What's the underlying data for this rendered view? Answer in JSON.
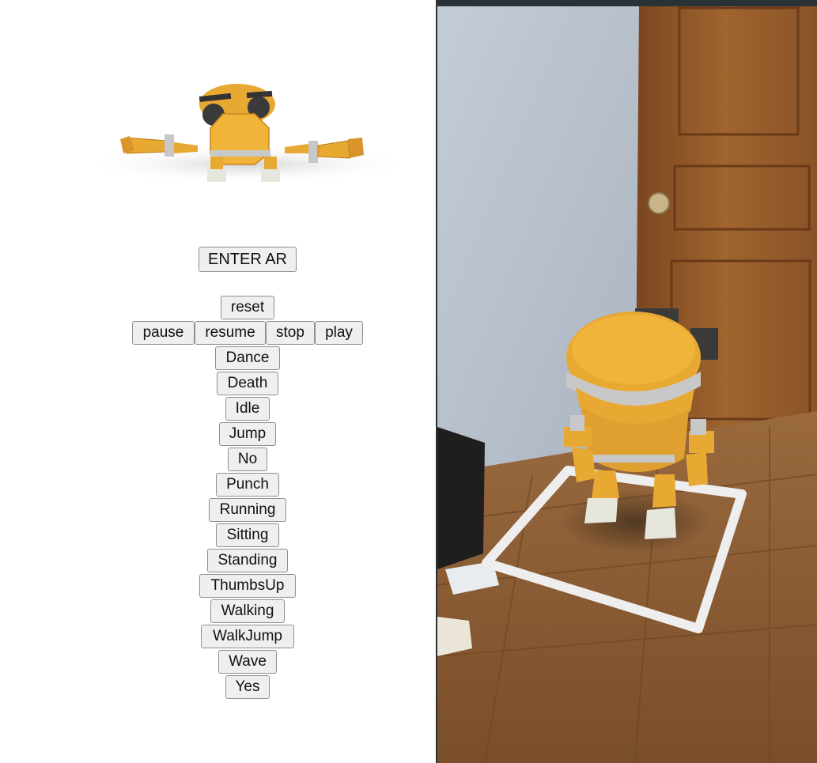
{
  "ar": {
    "enter_label": "ENTER AR"
  },
  "controls": {
    "reset": "reset",
    "pause": "pause",
    "resume": "resume",
    "stop": "stop",
    "play": "play"
  },
  "animations": [
    "Dance",
    "Death",
    "Idle",
    "Jump",
    "No",
    "Punch",
    "Running",
    "Sitting",
    "Standing",
    "ThumbsUp",
    "Walking",
    "WalkJump",
    "Wave",
    "Yes"
  ],
  "colors": {
    "robot_body": "#e8a932",
    "robot_dark": "#c9851c",
    "robot_trim": "#c8c8c8",
    "eye": "#3a3a3a",
    "floor": "#8a5a32",
    "wall": "#b9c2cc",
    "door": "#8a5228",
    "placement_ring": "#eeeeee"
  }
}
